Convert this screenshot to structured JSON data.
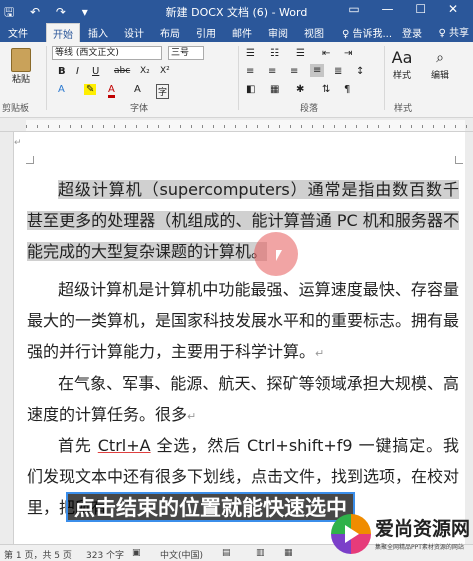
{
  "titlebar": {
    "title": "新建 DOCX 文档 (6) - Word",
    "quick_access": "🖫 ↶ ↷ ▾",
    "window_controls": "▭ — ☐ ✕"
  },
  "tabs": {
    "file": "文件",
    "home": "开始",
    "insert": "插入",
    "design": "设计",
    "layout": "布局",
    "references": "引用",
    "mailings": "邮件",
    "review": "审阅",
    "view": "视图",
    "tell_me": "♀ 告诉我...",
    "login": "登录",
    "share": "♀ 共享"
  },
  "ribbon": {
    "paste": "粘贴",
    "clipboard": "剪贴板",
    "font_name": "等线 (西文正文)",
    "font_size": "三号",
    "font_group": "字体",
    "paragraph_group": "段落",
    "styles": "样式",
    "editing": "编辑",
    "styles_group": "样式",
    "bold": "B",
    "italic": "I",
    "underline": "U",
    "strike": "abc",
    "subscript": "X₂",
    "superscript": "X²"
  },
  "document": {
    "para1_text": "超级计算机（supercomputers）通常是指由数百数千甚至更多的处理器（机组成的、能计算普通 PC 机和服务器不能完成的大型复杂课题的计算机。",
    "para2_text": "超级计算机是计算机中功能最强、运算速度最快、存容量最大的一类算机，是国家科技发展水平和的重要标志。拥有最强的并行计算能力，主要用于科学计算。",
    "para3_text": "在气象、军事、能源、航天、探矿等领域承担大规模、高速度的计算任务。很多",
    "para4_before": "首先 ",
    "para4_shortcut": "Ctrl+A",
    "para4_after": " 全选，然后 Ctrl+shift+f9 一键搞定。我们发现文本中还有很多下划线，点击文件，找到选项，在校对里，把所有",
    "para_mark": "↵"
  },
  "caption": "点击结束的位置就能快速选中",
  "statusbar": {
    "page": "第 1 页，共 5 页",
    "words": "323 个字",
    "lang": "中文(中国)"
  },
  "watermark": {
    "title": "爱尚资源网",
    "subtitle": "集聚全网精品PPT素材资源的网站"
  }
}
